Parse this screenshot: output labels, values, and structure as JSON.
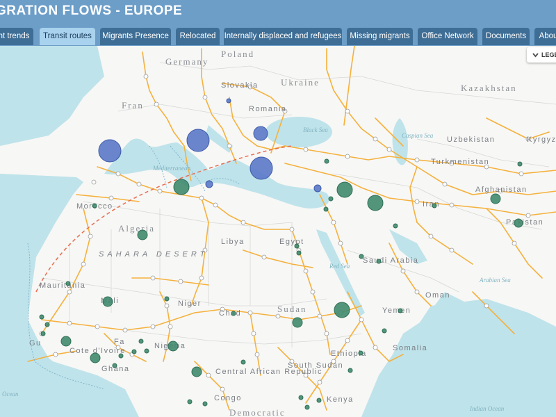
{
  "app": {
    "title": "GRATION FLOWS - EUROPE"
  },
  "tabs": [
    {
      "label": "nt trends",
      "active": false
    },
    {
      "label": "Transit routes",
      "active": true
    },
    {
      "label": "Migrants Presence",
      "active": false
    },
    {
      "label": "Relocated",
      "active": false
    },
    {
      "label": "Internally displaced and refugees",
      "active": false
    },
    {
      "label": "Missing migrants",
      "active": false
    },
    {
      "label": "Office Network",
      "active": false
    },
    {
      "label": "Documents",
      "active": false
    },
    {
      "label": "Abou",
      "active": false
    }
  ],
  "legend": {
    "label": "LEGE",
    "icon": "chevron-down-icon"
  },
  "map": {
    "colors": {
      "sea": "#bfe3ea",
      "land": "#f7f7f5",
      "routes": "#f5b13d",
      "bubble_blue": "#5b78c9",
      "bubble_green": "#3f8a6e",
      "flight": "#e86e4f"
    },
    "country_labels": [
      "Poland",
      "Germany",
      "Slovakia",
      "Ukraine",
      "Kazakhstan",
      "Fran",
      "Romania",
      "Black Sea",
      "Caspian Sea",
      "Uzbekistan",
      "Kyrgyz",
      "Turkmenistan",
      "Mediterranean",
      "Afghanistan",
      "Morocco",
      "Algeria",
      "Libya",
      "Egypt",
      "Iran",
      "Pakistan",
      "SAHARA DESERT",
      "Saudi Arabia",
      "Red Sea",
      "Mauritania",
      "Mali",
      "Niger",
      "Chad",
      "Sudan",
      "Yemen",
      "Oman",
      "Arabian Sea",
      "Nigeria",
      "Ghana",
      "Cote d'Ivoire",
      "Ethiopia",
      "Somalia",
      "South Sudan",
      "Central African Republic",
      "Congo",
      "Kenya",
      "Democratic",
      "Indian Ocean",
      "Ocean",
      "Gu",
      "Fa"
    ]
  }
}
